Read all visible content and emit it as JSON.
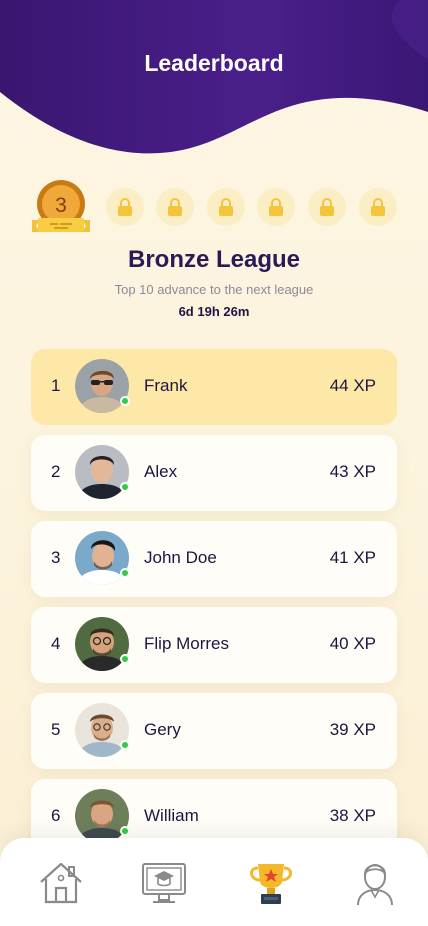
{
  "header": {
    "title": "Leaderboard"
  },
  "league": {
    "current_badge_number": "3",
    "title": "Bronze League",
    "subtitle": "Top 10 advance to the next league",
    "timer": "6d 19h 26m"
  },
  "leaderboard": [
    {
      "rank": "1",
      "name": "Frank",
      "xp": "44 XP",
      "highlight": true
    },
    {
      "rank": "2",
      "name": "Alex",
      "xp": "43 XP"
    },
    {
      "rank": "3",
      "name": "John Doe",
      "xp": "41 XP"
    },
    {
      "rank": "4",
      "name": "Flip Morres",
      "xp": "40 XP"
    },
    {
      "rank": "5",
      "name": "Gery",
      "xp": "39 XP"
    },
    {
      "rank": "6",
      "name": "William",
      "xp": "38 XP"
    }
  ],
  "bottom_nav": [
    {
      "icon": "home-icon"
    },
    {
      "icon": "course-icon"
    },
    {
      "icon": "trophy-icon",
      "active": true
    },
    {
      "icon": "profile-icon"
    }
  ],
  "colors": {
    "header_purple": "#3d1a78",
    "highlight": "#fde8a8",
    "bronze": "#d4891a",
    "online": "#2ecc40"
  }
}
